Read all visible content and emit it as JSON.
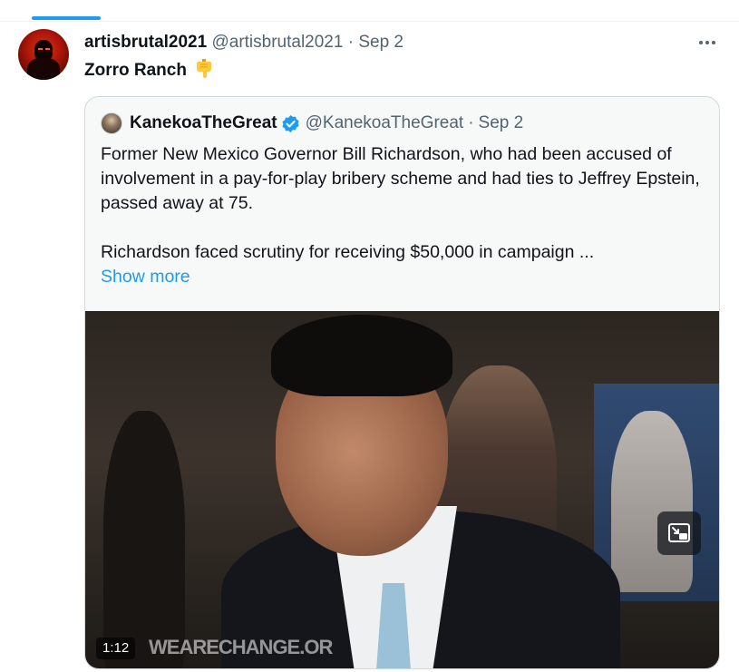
{
  "tweet": {
    "author_name": "artisbrutal2021",
    "author_handle": "@artisbrutal2021",
    "separator": "·",
    "date": "Sep 2",
    "text": "Zorro Ranch",
    "emoji": "👇",
    "more_icon": "more-horizontal-icon"
  },
  "quote": {
    "author_name": "KanekoaTheGreat",
    "author_handle": "@KanekoaTheGreat",
    "separator": "·",
    "date": "Sep 2",
    "verified_icon": "verified-badge-icon",
    "paragraph_1": "Former New Mexico Governor Bill Richardson, who had been accused of involvement in a pay-for-play bribery scheme and had ties to Jeffrey Epstein, passed away at 75.",
    "paragraph_2": "Richardson faced scrutiny for receiving $50,000 in campaign ...",
    "show_more": "Show more"
  },
  "video": {
    "duration": "1:12",
    "watermark": "WEARECHANGE.OR",
    "pip_icon": "picture-in-picture-icon"
  },
  "colors": {
    "accent": "#1d9bf0",
    "text": "#0f1419",
    "muted": "#536471",
    "border": "#cfd9de"
  }
}
